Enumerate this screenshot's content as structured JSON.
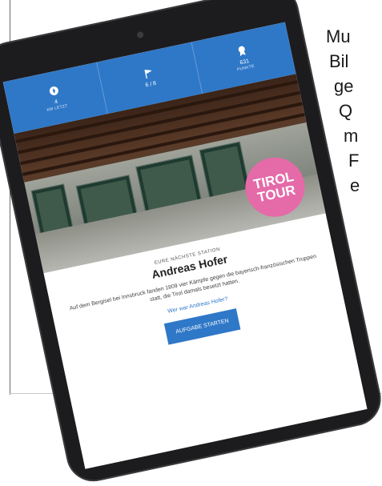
{
  "side_text": [
    "Mu",
    "Bil",
    "ge",
    "Q",
    "m",
    "F",
    "e"
  ],
  "stats": [
    {
      "icon": "compass-icon",
      "value": "4",
      "label": "KM LETZT"
    },
    {
      "icon": "flag-icon",
      "value": "6 / 8",
      "label": ""
    },
    {
      "icon": "medal-icon",
      "value": "631",
      "label": "PUNKTE"
    }
  ],
  "badge": {
    "line1": "TIROL",
    "line2": "TOUR"
  },
  "station": {
    "eyebrow": "EURE NÄCHSTE STATION",
    "name": "Andreas Hofer",
    "description": "Auf dem Bergisel bei Innsbruck fanden 1809 vier Kämpfe gegen die bayerisch-französischen Truppen statt, die Tirol damals besetzt hatten.",
    "link": "Wer war Andreas Hofer?",
    "button": "AUFGABE STARTEN"
  },
  "colors": {
    "accent": "#2f78c8",
    "badge": "#e46aa8"
  }
}
